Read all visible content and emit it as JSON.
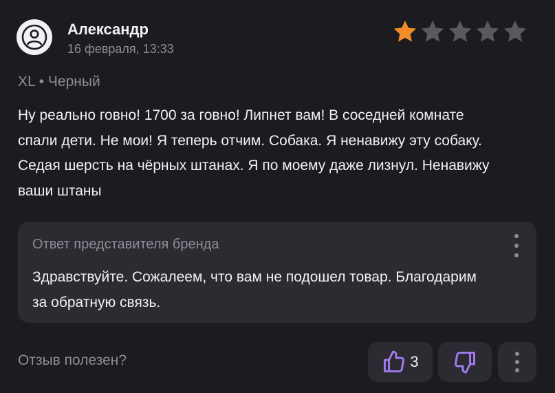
{
  "review": {
    "author": "Александр",
    "date": "16 февраля, 13:33",
    "rating": 1,
    "max_rating": 5,
    "variant": "XL • Черный",
    "text": "Ну реально говно! 1700 за говно! Липнет вам! В соседней комнате спали дети. Не мои! Я теперь отчим. Собака. Я ненавижу эту собаку. Седая шерсть на чёрных штанах. Я по моему даже лизнул. Ненавижу ваши штаны"
  },
  "brand_reply": {
    "title": "Ответ представителя бренда",
    "text": "Здравствуйте. Сожалеем, что вам не подошел товар. Благодарим за обратную связь."
  },
  "footer": {
    "helpful_label": "Отзыв полезен?",
    "like_count": "3"
  },
  "colors": {
    "background": "#1c1b20",
    "panel": "#2c2b31",
    "star_filled": "#f28c28",
    "star_empty": "#5a5960",
    "accent": "#a47cf3",
    "muted_text": "#8e8d96"
  },
  "icons": {
    "avatar": "user-icon",
    "star": "star-icon",
    "like": "thumbs-up-icon",
    "dislike": "thumbs-down-icon",
    "menu": "kebab-menu-icon"
  }
}
